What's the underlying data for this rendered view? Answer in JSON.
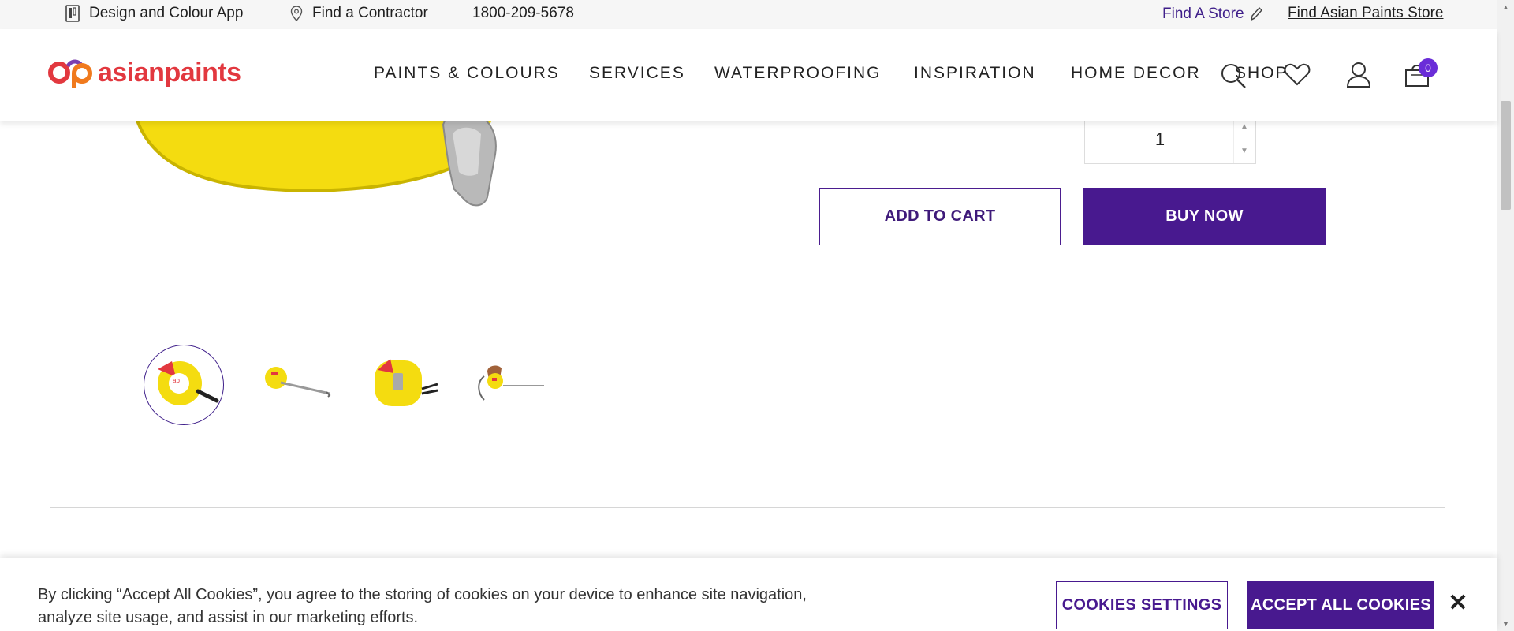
{
  "utility_bar": {
    "design_app": "Design and Colour App",
    "find_contractor": "Find a Contractor",
    "phone": "1800-209-5678",
    "find_a_store": "Find A Store",
    "find_asian_paints_store": "Find Asian Paints Store"
  },
  "header": {
    "logo_text": "asianpaints",
    "nav": [
      "PAINTS & COLOURS",
      "SERVICES",
      "WATERPROOFING",
      "INSPIRATION",
      "HOME DECOR",
      "SHOP"
    ],
    "cart_count": "0",
    "icons": [
      "search-icon",
      "wishlist-icon",
      "user-icon",
      "cart-icon"
    ]
  },
  "product": {
    "quantity": "1",
    "add_to_cart": "ADD TO CART",
    "buy_now": "BUY NOW",
    "thumbnails": [
      "thumbnail-tape-front",
      "thumbnail-tape-extended",
      "thumbnail-tape-back",
      "thumbnail-tape-in-hand"
    ]
  },
  "cookie_banner": {
    "text": "By clicking “Accept All Cookies”, you agree to the storing of cookies on your device to enhance site navigation, analyze site usage, and assist in our marketing efforts.",
    "settings": "COOKIES SETTINGS",
    "accept": "ACCEPT ALL COOKIES",
    "close": "✕"
  },
  "colors": {
    "brand_purple": "#48198f",
    "logo_red": "#e2383f",
    "badge": "#6a2dd8"
  }
}
